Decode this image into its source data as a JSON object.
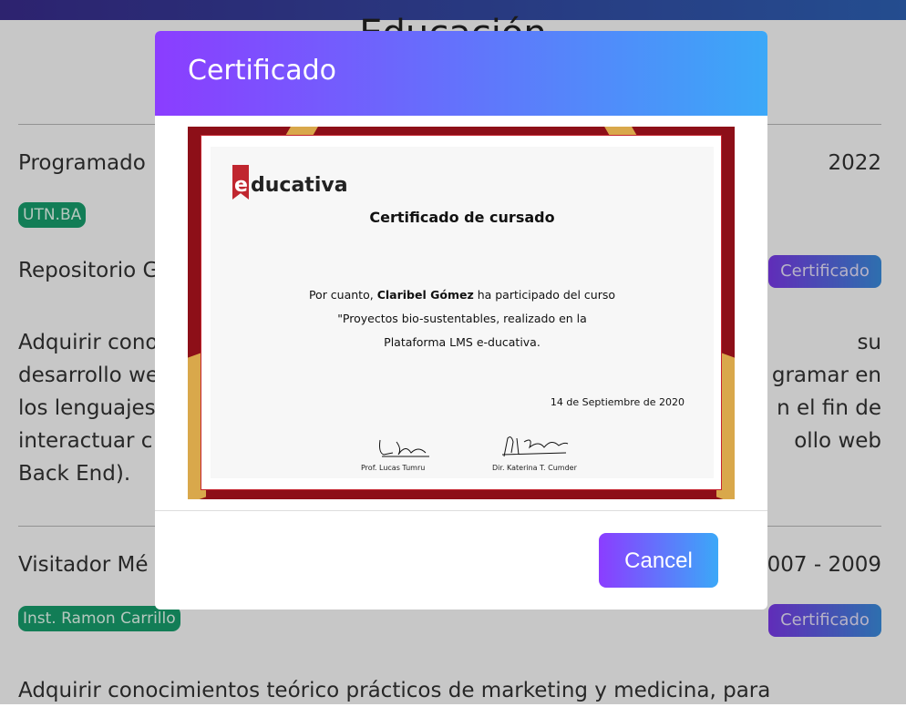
{
  "background": {
    "section_title": "Educación",
    "entries": [
      {
        "title": "Programado",
        "year": "2022",
        "institution": "UTN.BA",
        "subtitle": "Repositorio G",
        "certificate_label": "Certificado",
        "description_lines": [
          "Adquirir cono",
          "desarrollo we",
          "los lenguajes",
          "interactuar c",
          "Back End)."
        ],
        "description_lines_right": [
          "su",
          "gramar en",
          "n el fin de",
          "ollo web"
        ]
      },
      {
        "title": "Visitador Mé",
        "year": "007 - 2009",
        "institution": "Inst. Ramon Carrillo",
        "certificate_label": "Certificado",
        "description": "Adquirir conocimientos teórico prácticos de marketing y medicina, para"
      }
    ]
  },
  "modal": {
    "title": "Certificado",
    "cancel_label": "Cancel",
    "certificate": {
      "logo_e": "e",
      "logo_rest": "ducativa",
      "heading": "Certificado de cursado",
      "line1_prefix": "Por cuanto, ",
      "student_name": "Claribel Gómez",
      "line1_suffix": " ha participado del curso",
      "line2": "\"Proyectos bio-sustentables, realizado en la",
      "line3": "Plataforma LMS e-ducativa.",
      "date": "14 de Septiembre de 2020",
      "signer1": "Prof. Lucas Tumru",
      "signer2": "Dir. Katerina T. Cumder"
    }
  },
  "colors": {
    "accent_start": "#8b3dff",
    "accent_end": "#3ba8f8",
    "institution_badge": "#18a16f",
    "certificate_frame": "#8d0f18"
  }
}
